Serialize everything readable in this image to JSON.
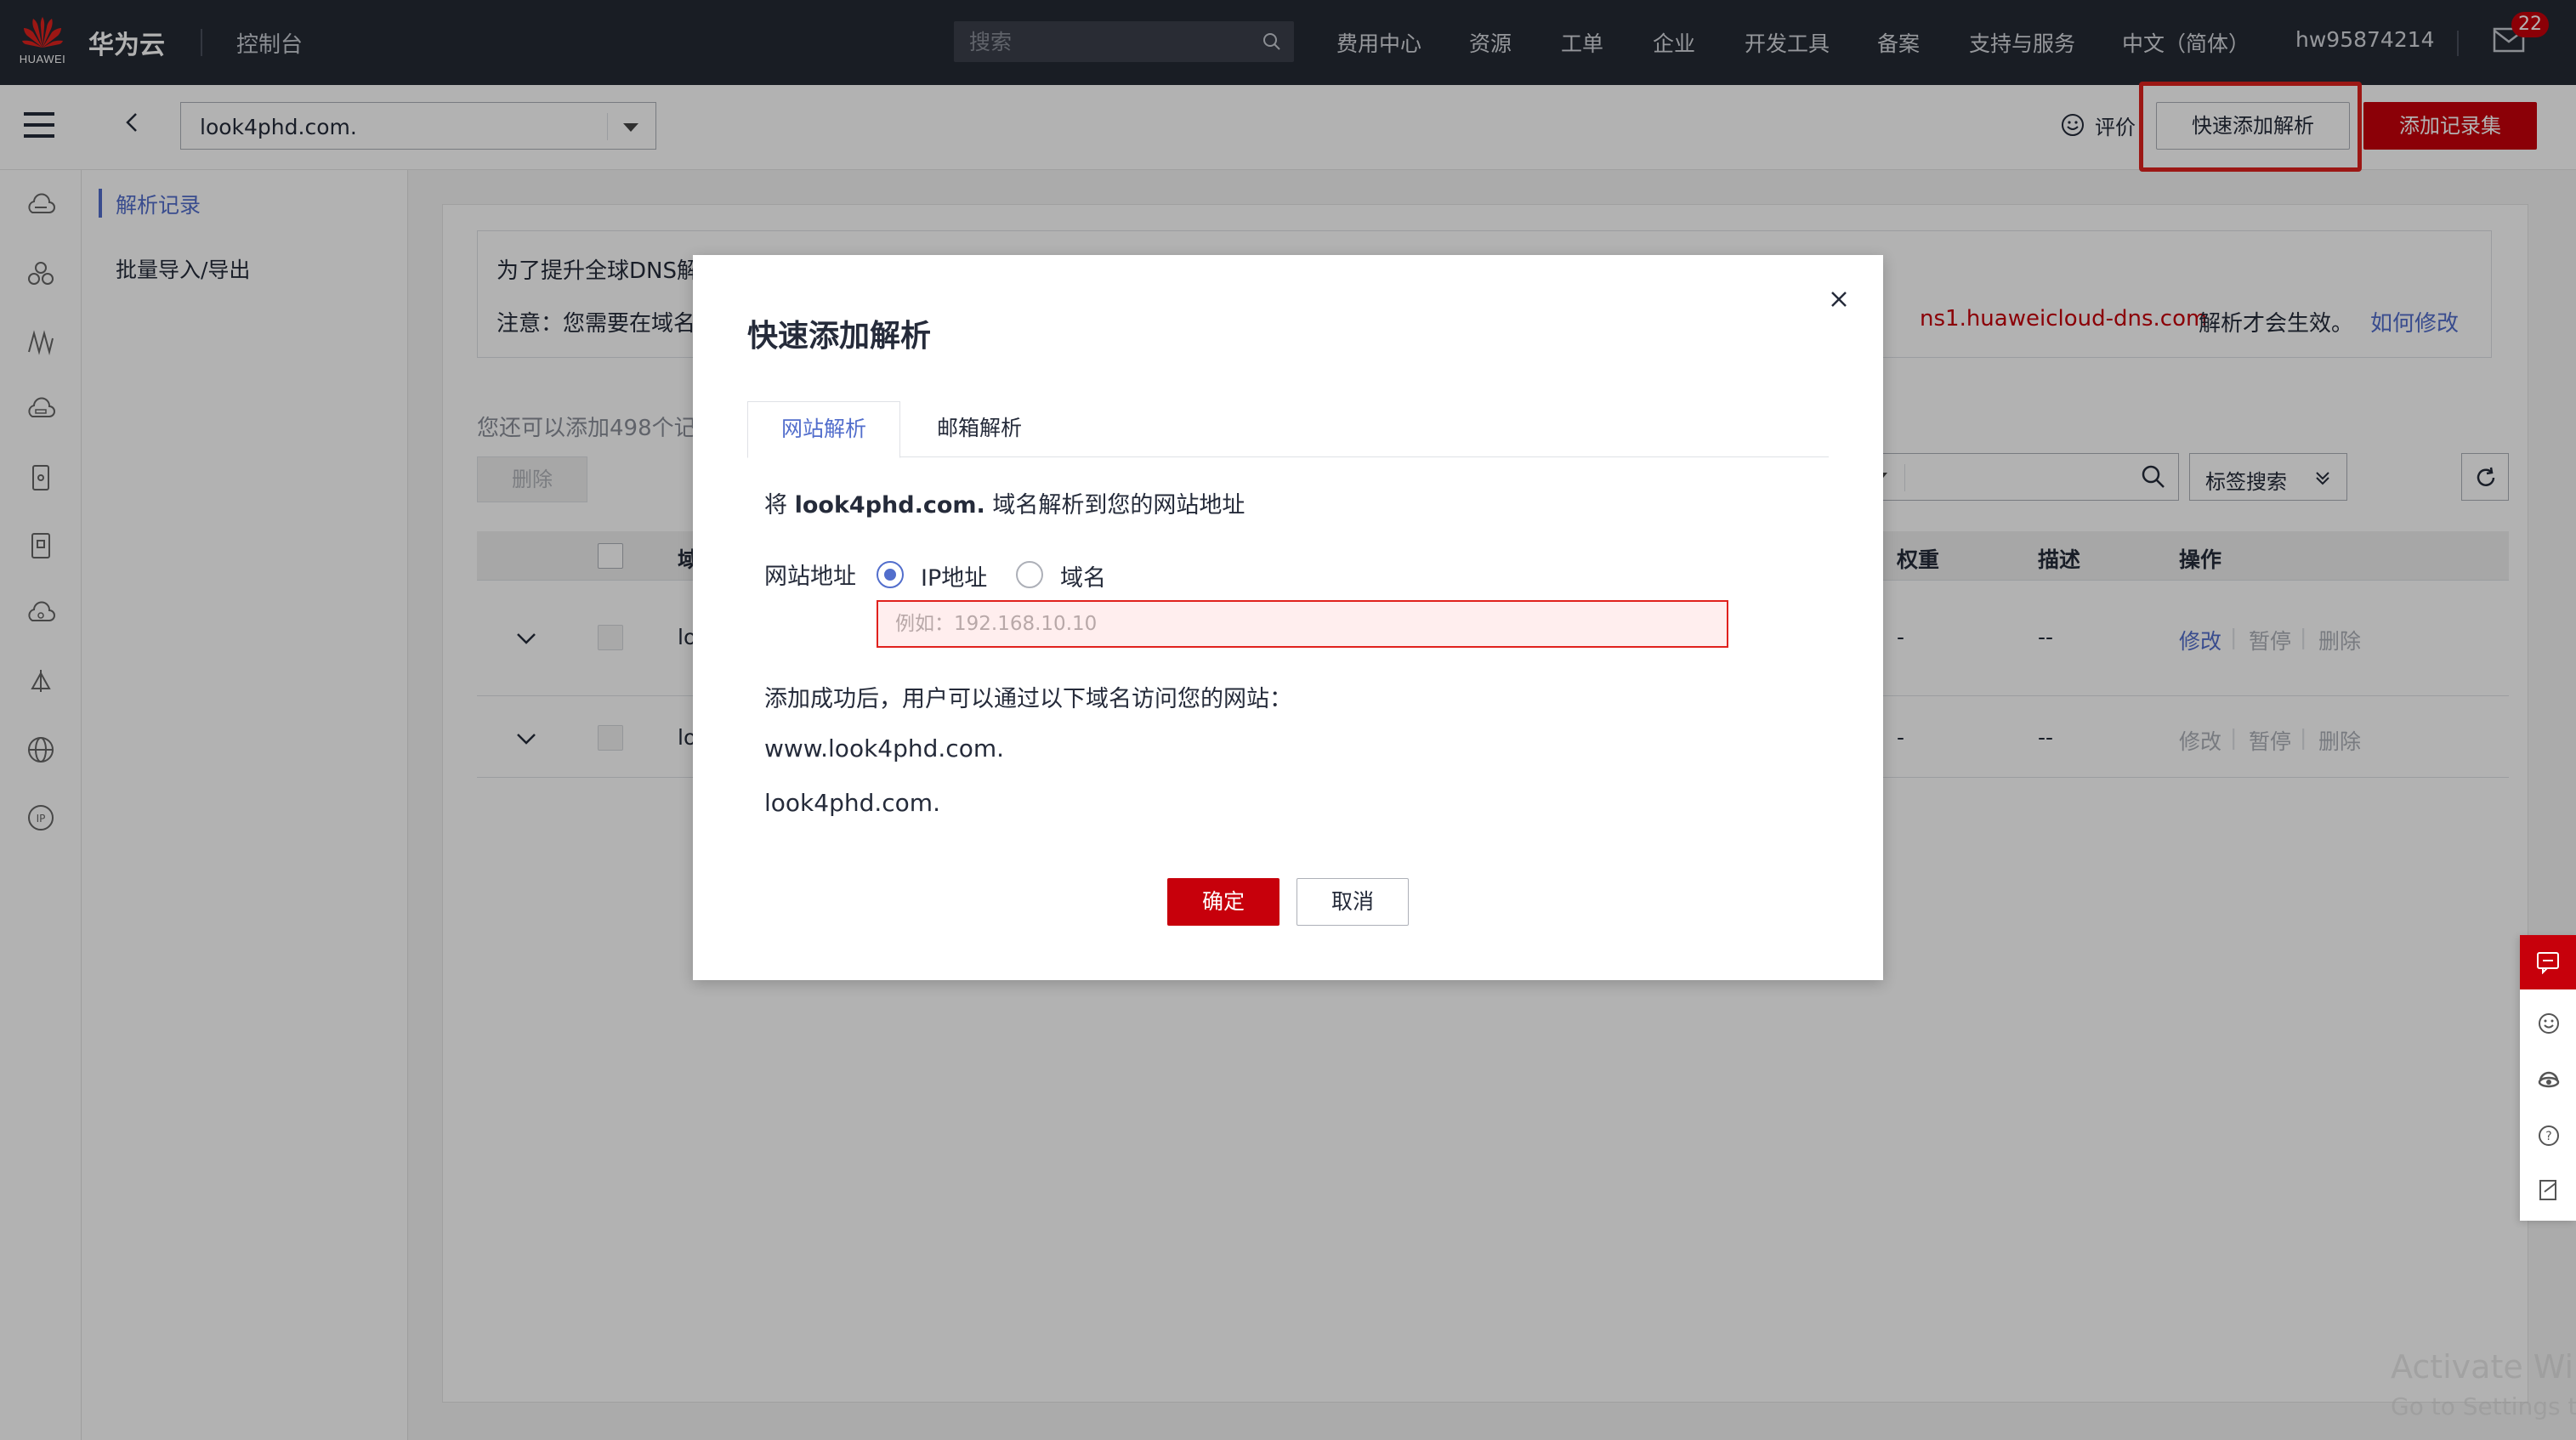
{
  "topbar": {
    "logo_text": "HUAWEI",
    "brand": "华为云",
    "console": "控制台",
    "search_placeholder": "搜索",
    "nav": [
      "费用中心",
      "资源",
      "工单",
      "企业",
      "开发工具",
      "备案",
      "支持与服务",
      "中文（简体）",
      "hw95874214"
    ],
    "mail_badge": "22"
  },
  "subheader": {
    "domain": "look4phd.com.",
    "rate_label": "评价",
    "quick_add_label": "快速添加解析",
    "add_recordset_label": "添加记录集"
  },
  "subnav": {
    "items": [
      "解析记录",
      "批量导入/导出"
    ]
  },
  "main": {
    "notice_line1": "为了提升全球DNS解",
    "notice_line2": "注意：您需要在域名",
    "notice_dns": "ns1.huaweicloud-dns.com",
    "notice_dns_tail": "解析才会生效。",
    "notice_link": "如何修改",
    "quota": "您还可以添加498个记",
    "delete_label": "删除",
    "tag_search_label": "标签搜索",
    "table_headers": [
      "域",
      "权重",
      "描述",
      "操作"
    ],
    "rows": [
      {
        "name": "lo",
        "weight": "-",
        "desc": "--",
        "actions": [
          "修改",
          "暂停",
          "删除"
        ],
        "actions_enabled": true
      },
      {
        "name": "lo",
        "weight": "-",
        "desc": "--",
        "actions": [
          "修改",
          "暂停",
          "删除"
        ],
        "actions_enabled": false
      }
    ]
  },
  "dialog": {
    "title": "快速添加解析",
    "tabs": [
      "网站解析",
      "邮箱解析"
    ],
    "desc_prefix": "将 ",
    "desc_domain": "look4phd.com.",
    "desc_suffix": " 域名解析到您的网站地址",
    "field_label": "网站地址",
    "radio_ip": "IP地址",
    "radio_domain": "域名",
    "ip_value": "",
    "ip_placeholder": "例如：192.168.10.10",
    "success_text": "添加成功后，用户可以通过以下域名访问您的网站：",
    "url1": "www.look4phd.com.",
    "url2": "look4phd.com.",
    "ok_label": "确定",
    "cancel_label": "取消"
  },
  "watermark": {
    "line1": "Activate Wir",
    "line2": "Go to Settings to"
  },
  "colors": {
    "brand_red": "#c7000b",
    "link_blue": "#526ecc",
    "topbar_bg": "#252a34"
  }
}
